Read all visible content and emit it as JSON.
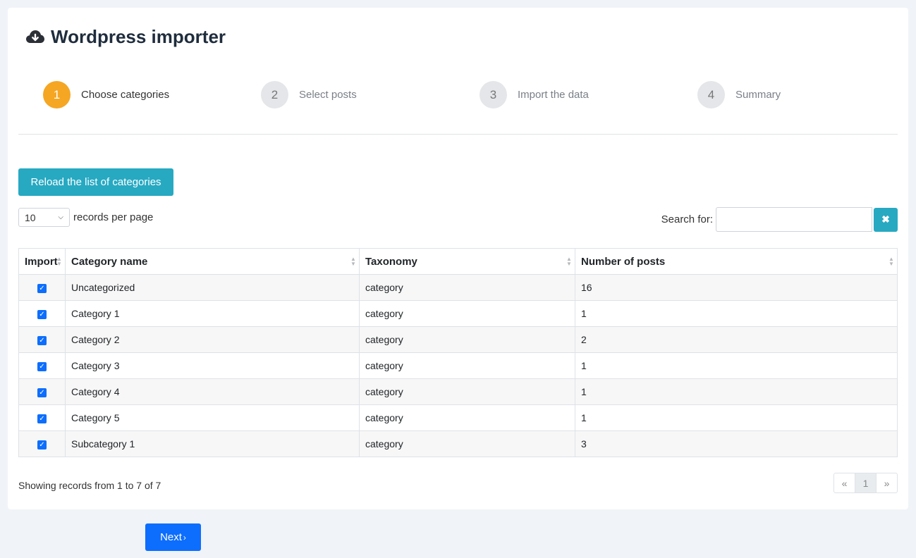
{
  "app": {
    "title": "Wordpress importer",
    "title_icon": "cloud-download-icon"
  },
  "steps": [
    {
      "number": "1",
      "label": "Choose categories",
      "active": true
    },
    {
      "number": "2",
      "label": "Select posts",
      "active": false
    },
    {
      "number": "3",
      "label": "Import the data",
      "active": false
    },
    {
      "number": "4",
      "label": "Summary",
      "active": false
    }
  ],
  "toolbar": {
    "reload_label": "Reload the list of categories",
    "per_page_value": "10",
    "per_page_suffix": "records per page",
    "search_label": "Search for:",
    "search_value": "",
    "clear_icon": "times-icon",
    "clear_symbol": "✖"
  },
  "table": {
    "headers": [
      "Import",
      "Category name",
      "Taxonomy",
      "Number of posts"
    ],
    "rows": [
      {
        "checked": true,
        "name": "Uncategorized",
        "taxonomy": "category",
        "posts": "16"
      },
      {
        "checked": true,
        "name": "Category 1",
        "taxonomy": "category",
        "posts": "1"
      },
      {
        "checked": true,
        "name": "Category 2",
        "taxonomy": "category",
        "posts": "2"
      },
      {
        "checked": true,
        "name": "Category 3",
        "taxonomy": "category",
        "posts": "1"
      },
      {
        "checked": true,
        "name": "Category 4",
        "taxonomy": "category",
        "posts": "1"
      },
      {
        "checked": true,
        "name": "Category 5",
        "taxonomy": "category",
        "posts": "1"
      },
      {
        "checked": true,
        "name": "Subcategory 1",
        "taxonomy": "category",
        "posts": "3"
      }
    ]
  },
  "footer": {
    "info": "Showing records from 1 to 7 of 7",
    "pager": {
      "prev": "«",
      "current": "1",
      "next": "»"
    }
  },
  "actions": {
    "next_label": "Next",
    "next_chevron": "›"
  },
  "colors": {
    "active_step": "#f5a623",
    "info_button": "#27a9c2",
    "primary_button": "#0d6efd"
  }
}
